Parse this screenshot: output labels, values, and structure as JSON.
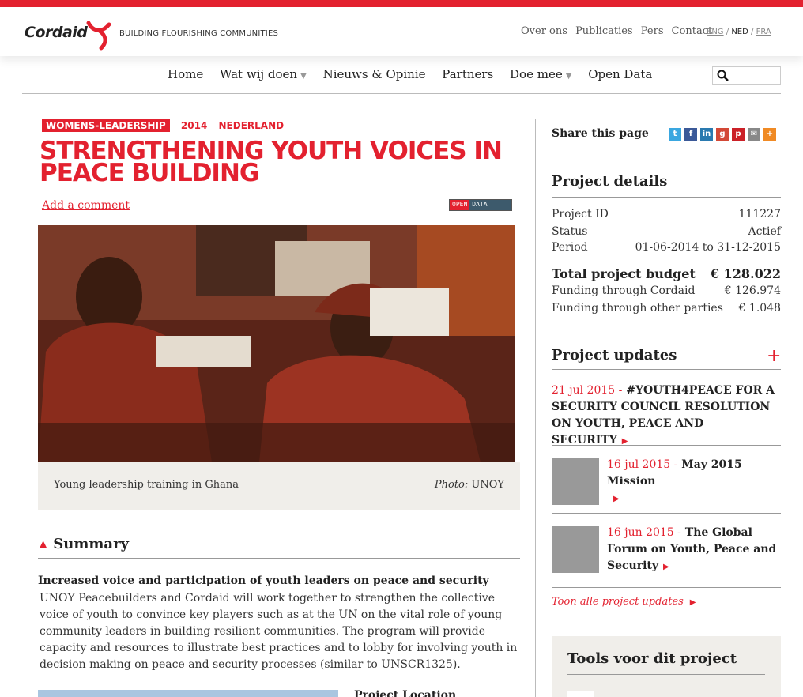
{
  "brand": {
    "name": "Cordaid",
    "tagline": "BUILDING FLOURISHING COMMUNITIES",
    "accent": "#e3212f"
  },
  "top_links": [
    "Over ons",
    "Publicaties",
    "Pers",
    "Contact"
  ],
  "languages": {
    "eng": "ENG",
    "ned": "NED",
    "fra": "FRA",
    "sep": "/"
  },
  "nav": {
    "home": "Home",
    "wat_wij_doen": "Wat wij doen",
    "nieuws": "Nieuws & Opinie",
    "partners": "Partners",
    "doe_mee": "Doe mee",
    "open_data": "Open Data"
  },
  "article": {
    "tag": "WOMENS-LEADERSHIP",
    "year": "2014",
    "country": "NEDERLAND",
    "title": "STRENGTHENING YOUTH VOICES IN PEACE BUILDING",
    "add_comment": "Add a comment",
    "open_data_badge": {
      "left": "OPEN",
      "right": "DATA"
    },
    "photo_caption": "Young leadership training in Ghana",
    "photo_credit_label": "Photo:",
    "photo_credit": "UNOY",
    "summary_heading": "Summary",
    "summary_lead": "Increased voice and participation of youth leaders on peace and security",
    "summary_body": "UNOY Peacebuilders and Cordaid will work together to strengthen the collective voice of youth to convince key players such as at the UN on the vital role of young community leaders in building resilient communities. The program will provide capacity and resources to illustrate best practices and to lobby for involving youth in decision making on peace and security processes (similar to UNSCR1325).",
    "project_location_heading": "Project Location"
  },
  "sidebar": {
    "share_label": "Share this page",
    "details_heading": "Project details",
    "details": [
      {
        "label": "Project ID",
        "value": "111227"
      },
      {
        "label": "Status",
        "value": "Actief"
      },
      {
        "label": "Period",
        "value": "01-06-2014 to 31-12-2015"
      }
    ],
    "budget": [
      {
        "label": "Total project budget",
        "value": "€ 128.022"
      },
      {
        "label": "Funding through Cordaid",
        "value": "€ 126.974"
      },
      {
        "label": "Funding through other parties",
        "value": "€ 1.048"
      }
    ],
    "updates_heading": "Project updates",
    "updates": [
      {
        "date": "21 jul 2015 -",
        "title": "#YOUTH4PEACE FOR A SECURITY COUNCIL RESOLUTION ON YOUTH, PEACE AND SECURITY"
      },
      {
        "date": "16 jul 2015 -",
        "title": "May 2015 Mission"
      },
      {
        "date": "16 jun 2015 -",
        "title": "The Global Forum on Youth, Peace and Security"
      }
    ],
    "all_updates": "Toon alle project updates",
    "tools_heading": "Tools voor dit project"
  }
}
